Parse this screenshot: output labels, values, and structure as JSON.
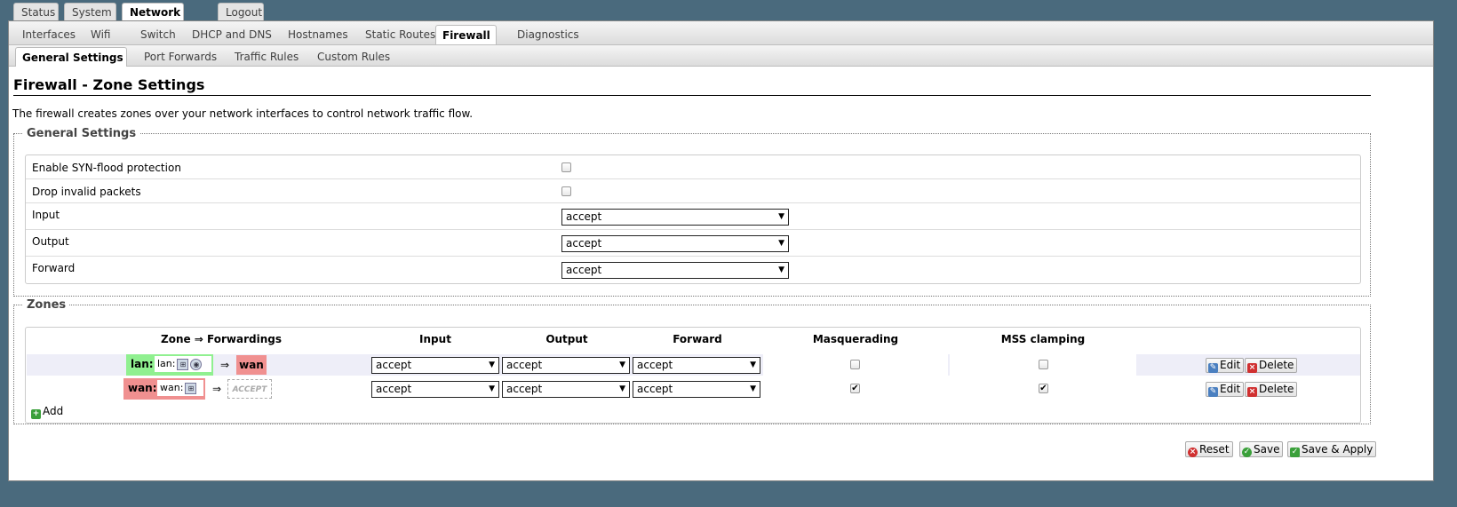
{
  "top_tabs": [
    "Status",
    "System",
    "Network",
    "Logout"
  ],
  "nav_tabs": [
    "Interfaces",
    "Wifi",
    "Switch",
    "DHCP and DNS",
    "Hostnames",
    "Static Routes",
    "Firewall",
    "Diagnostics"
  ],
  "sub_tabs": [
    "General Settings",
    "Port Forwards",
    "Traffic Rules",
    "Custom Rules"
  ],
  "page_title": "Firewall - Zone Settings",
  "description": "The firewall creates zones over your network interfaces to control network traffic flow.",
  "general": {
    "legend": "General Settings",
    "syn_flood_label": "Enable SYN-flood protection",
    "drop_invalid_label": "Drop invalid packets",
    "input_label": "Input",
    "input_value": "accept",
    "output_label": "Output",
    "output_value": "accept",
    "forward_label": "Forward",
    "forward_value": "accept"
  },
  "zones": {
    "legend": "Zones",
    "headers": [
      "Zone ⇒ Forwardings",
      "Input",
      "Output",
      "Forward",
      "Masquerading",
      "MSS clamping"
    ],
    "rows": [
      {
        "name": "lan:",
        "networks": "lan:",
        "arrow": "⇒",
        "forward_to": "wan",
        "input": "accept",
        "output": "accept",
        "forward": "accept",
        "masquerading": false,
        "mss_clamping": false
      },
      {
        "name": "wan:",
        "networks": "wan:",
        "arrow": "⇒",
        "forward_to": "ACCEPT",
        "input": "accept",
        "output": "accept",
        "forward": "accept",
        "masquerading": true,
        "mss_clamping": true
      }
    ],
    "edit_label": "Edit",
    "delete_label": "Delete",
    "add_label": "Add"
  },
  "footer": {
    "reset_label": "Reset",
    "save_label": "Save",
    "save_apply_label": "Save & Apply"
  },
  "colors": {
    "lan_zone": "#90f090",
    "wan_zone": "#f09090",
    "background": "#4a6a7d"
  }
}
